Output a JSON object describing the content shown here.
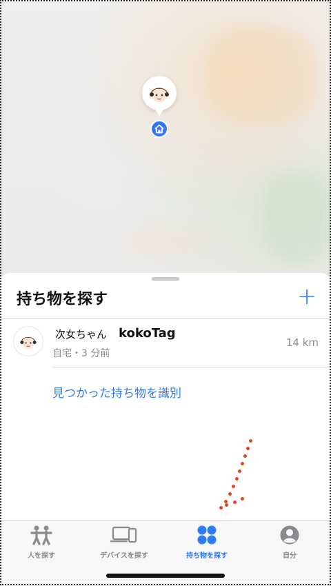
{
  "map": {
    "icons": [
      "girl-avatar-icon",
      "home-icon"
    ],
    "home_badge_color": "#3478f6"
  },
  "sheet": {
    "title": "持ち物を探す",
    "add_label": "+",
    "items": [
      {
        "owner": "次女ちゃん",
        "name": "kokoTag",
        "subtitle": "自宅・3 分前",
        "distance": "14 km",
        "avatar_icon": "girl-avatar-icon"
      }
    ],
    "identify_link": "見つかった持ち物を識別"
  },
  "tabs": [
    {
      "label": "人を探す",
      "icon": "people-icon",
      "active": false
    },
    {
      "label": "デバイスを探す",
      "icon": "devices-icon",
      "active": false
    },
    {
      "label": "持ち物を探す",
      "icon": "items-icon",
      "active": true
    },
    {
      "label": "自分",
      "icon": "person-circle-icon",
      "active": false
    }
  ],
  "colors": {
    "accent": "#2f7cf6",
    "annotation": "#e6441f"
  }
}
